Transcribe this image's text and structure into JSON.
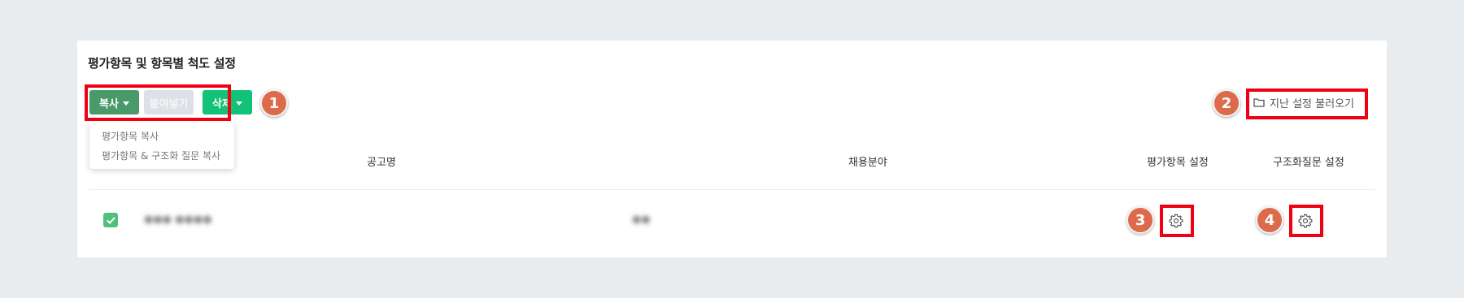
{
  "section": {
    "title": "평가항목 및 항목별 척도 설정"
  },
  "toolbar": {
    "copy_label": "복사",
    "paste_label": "붙여넣기",
    "delete_label": "삭제",
    "load_label": "지난 설정 불러오기"
  },
  "copy_menu": {
    "items": [
      "평가항목 복사",
      "평가항목 & 구조화 질문 복사"
    ]
  },
  "table": {
    "headers": {
      "title": "공고명",
      "field": "채용분야",
      "eval_setting": "평가항목 설정",
      "struct_setting": "구조화질문 설정"
    },
    "rows": [
      {
        "checked": true,
        "title": "●●● ●●●●",
        "field": "●●"
      }
    ]
  },
  "annotations": {
    "markers": [
      "1",
      "2",
      "3",
      "4"
    ]
  },
  "colors": {
    "copy_button": "#4a9a69",
    "paste_button_disabled": "#dde1e6",
    "delete_button": "#12c276",
    "checkbox": "#4fbf7d",
    "highlight": "#f00012",
    "marker": "#dc6a4b"
  },
  "icons": {
    "folder": "folder-icon",
    "gear": "gear-icon",
    "caret": "caret-down-icon",
    "check": "check-icon"
  }
}
